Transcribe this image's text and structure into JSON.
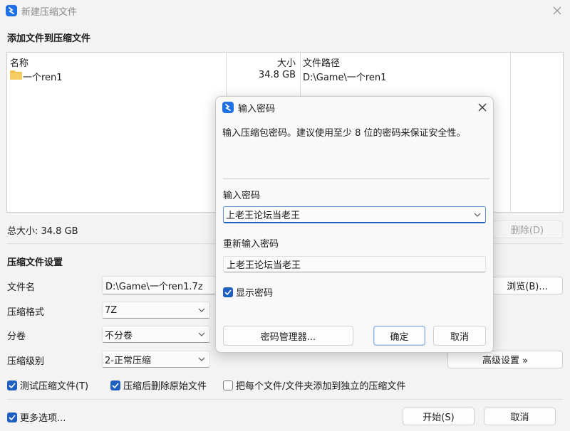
{
  "window": {
    "title": "新建压缩文件",
    "section_title": "添加文件到压缩文件"
  },
  "file_list": {
    "columns": [
      "名称",
      "大小",
      "文件路径"
    ],
    "rows": [
      {
        "name": "一个ren1",
        "size": "34.8 GB",
        "path": "D:\\Game\\一个ren1",
        "icon": "folder-icon"
      }
    ]
  },
  "summary": {
    "total_size": "总大小: 34.8 GB",
    "delete_button": "删除(D)"
  },
  "settings": {
    "title": "压缩文件设置",
    "filename_label": "文件名",
    "filename_value": "D:\\Game\\一个ren1.7z",
    "browse_button": "浏览(B)...",
    "format_label": "压缩格式",
    "format_value": "7Z",
    "split_label": "分卷",
    "split_value": "不分卷",
    "level_label": "压缩级别",
    "level_value": "2-正常压缩",
    "advanced_button": "高级设置 »",
    "test_checkbox": {
      "label": "测试压缩文件(T)",
      "checked": true
    },
    "delete_after_checkbox": {
      "label": "压缩后删除原始文件",
      "checked": true
    },
    "separate_checkbox": {
      "label": "把每个文件/文件夹添加到独立的压缩文件",
      "checked": false
    }
  },
  "footer": {
    "more_options": {
      "label": "更多选项...",
      "checked": true
    },
    "start_button": "开始(S)",
    "cancel_button": "取消"
  },
  "password_dialog": {
    "title": "输入密码",
    "description": "输入压缩包密码。建议使用至少 8 位的密码来保证安全性。",
    "password_label": "输入密码",
    "password_value": "上老王论坛当老王",
    "reenter_label": "重新输入密码",
    "reenter_value": "上老王论坛当老王",
    "show_password": {
      "label": "显示密码",
      "checked": true
    },
    "manager_button": "密码管理器...",
    "ok_button": "确定",
    "cancel_button": "取消"
  },
  "colors": {
    "accent": "#1f5fbf",
    "app_icon": "#1f6fe5",
    "folder": "#f2c14e"
  }
}
